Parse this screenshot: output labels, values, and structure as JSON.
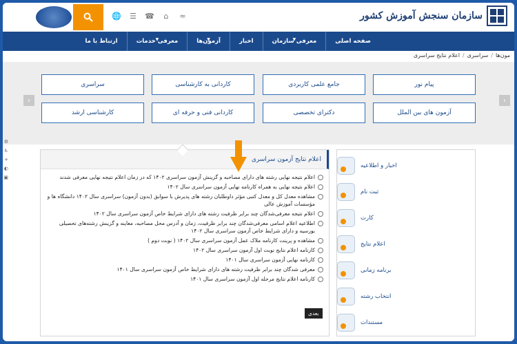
{
  "header": {
    "logo_text": "سازمان سنجش آموزش کشور",
    "search_icon": "search-icon",
    "top_icons": [
      "rss-icon",
      "home-icon",
      "phone-icon",
      "share-icon",
      "globe-icon"
    ]
  },
  "nav": {
    "items": [
      {
        "label": "صفحه اصلی",
        "dropdown": false
      },
      {
        "label": "معرفی سازمان",
        "dropdown": true
      },
      {
        "label": "اخبار",
        "dropdown": false
      },
      {
        "label": "آزمون‌ها",
        "dropdown": true
      },
      {
        "label": "معرفی خدمات",
        "dropdown": true
      },
      {
        "label": "ارتباط با ما",
        "dropdown": false
      }
    ]
  },
  "breadcrumb": {
    "items": [
      "مون‌ها",
      "سراسری",
      "اعلام نتایج سراسری"
    ]
  },
  "exam_grid": {
    "row1": [
      "پیام نور",
      "جامع علمی کاربردی",
      "کاردانی به کارشناسی",
      "سراسری"
    ],
    "row2": [
      "آزمون های بین الملل",
      "دکترای تخصصی",
      "کاردانی فنی و حرفه ای",
      "کارشناسی ارشد"
    ]
  },
  "sidebar": {
    "items": [
      "اخبار و اطلاعیه",
      "ثبت نام",
      "کارت",
      "اعلام نتایج",
      "برنامه زمانی",
      "انتخاب رشته",
      "مستندات"
    ]
  },
  "news_panel": {
    "title": "اعلام نتایج آزمون سراسری",
    "items": [
      "اعلام نتیجه نهایی رشته های دارای مصاحبه و گزینش آزمون سراسری ۱۴۰۲ که در زمان اعلام نتیجه نهایی معرفی شدند",
      "اعلام نتیجه نهایی به همراه کارنامه نهایی آزمون سراسری سال ۱۴۰۲",
      "مشاهده معدل کل و معدل کتبی مؤثر داوطلبان رشته های پذیرش با سوابق (بدون آزمون) سراسری سال ۱۴۰۲ دانشگاه ها و مؤسسات آموزش عالی",
      "اعلام نتیجه معرفی‌شدگان چند برابر ظرفیت رشته های دارای شرایط خاص آزمون سراسری سال ۱۴۰۲",
      "اطلاعیه اعلام اسامی معرفی‌شدگان چند برابر ظرفیت، زمان و آدرس محل مصاحبه، معاینه و گزینش رشته‌های تحصیلی بورسیه و دارای شرایط خاص آزمون سراسری سال ۱۴۰۲",
      "مشاهده و پرینت کارنامه ملاک عمل آزمون سراسری سال ۱۴۰۲ ( نوبت دوم )",
      "کارنامه اعلام نتایج نوبت اول آزمون سراسری سال ۱۴۰۲",
      "کارنامه نهایی آزمون سراسری سال ۱۴۰۱",
      "معرفی شدگان چند برابر ظرفیت رشته های دارای شرایط خاص آزمون سراسری سال ۱۴۰۱",
      "کارنامه اعلام نتایج مرحله اول آزمون سراسری سال ۱۴۰۱"
    ],
    "next_label": "بعدی"
  },
  "colors": {
    "nav": "#1b4a8c",
    "accent": "#f39200",
    "tile_border": "#2f6db5"
  }
}
